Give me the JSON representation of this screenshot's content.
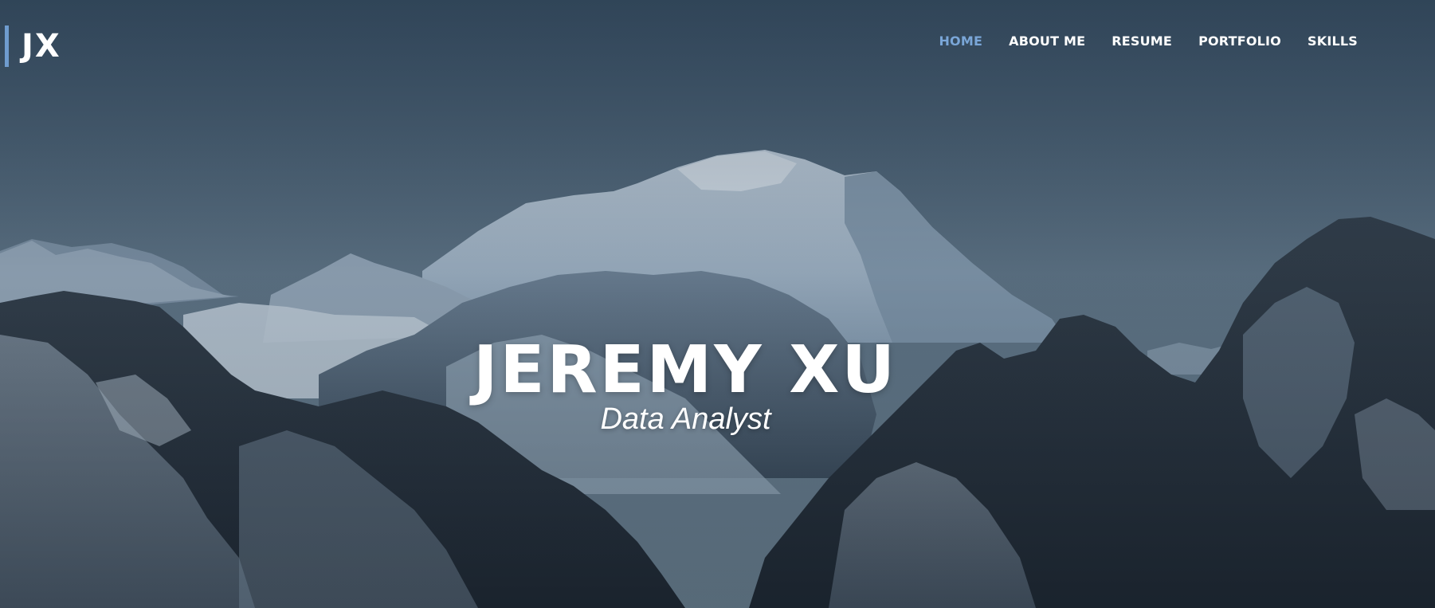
{
  "brand": {
    "logo_text": "JX",
    "accent_color": "#6f9ccf"
  },
  "nav": {
    "active_color": "#7aa6d8",
    "items": [
      {
        "label": "HOME",
        "active": true
      },
      {
        "label": "ABOUT ME",
        "active": false
      },
      {
        "label": "RESUME",
        "active": false
      },
      {
        "label": "PORTFOLIO",
        "active": false
      },
      {
        "label": "SKILLS",
        "active": false
      }
    ]
  },
  "hero": {
    "name": "JEREMY XU",
    "role": "Data Analyst",
    "background": "snow-capped-mountains-photo"
  }
}
